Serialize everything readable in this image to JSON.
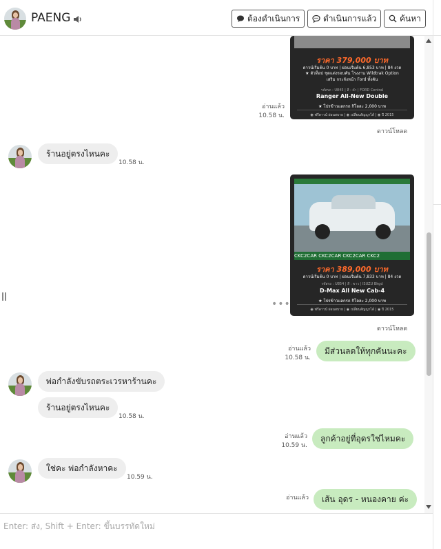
{
  "header": {
    "contact_name": "PAENG",
    "buttons": {
      "todo": "ต้องดำเนินการ",
      "done": "ดำเนินการแล้ว",
      "search": "ค้นหา"
    }
  },
  "cards": [
    {
      "price": "ราคา 379,000 บาท",
      "finance": "ดาวน์เริ่มต้น 0 บาท | ผ่อนเริ่มต้น 6,853 บาท | 84 งวด",
      "options": [
        "★ ตัวท็อป ชุดแต่งรอบคัน โรงงาน Wildtrak Option",
        "เสริม กระจังหน้า Ford ทั้งคัน"
      ],
      "spec": "รหัสรถ : U845 | สี : ดำ | FORD Central",
      "model": "Ranger All-New Double",
      "promo": "★ โปรข้าวแลกรถ กิโลละ 2,000 บาท",
      "footer": "◉ ฟรีดาวน์ ผ่อนสบาย | ◉ เปลี่ยนสัญญาได้ | ◉ ปี 2015"
    },
    {
      "brand_strip": "CKC2CAR CKC2CAR CKC2CAR CKC2",
      "price": "ราคา 389,000 บาท",
      "finance": "ดาวน์เริ่มต้น 0 บาท | ผ่อนเริ่มต้น 7,833 บาท | 84 งวด",
      "spec": "รหัสรถ : U854 | สี : ขาว | ISUZU Bkgd",
      "model": "D-Max All New Cab-4",
      "promo": "★ โปรข้าวแลกรถ กิโลละ 2,000 บาท",
      "footer": "◉ ฟรีดาวน์ ผ่อนสบาย | ◉ เปลี่ยนสัญญาได้ | ◉ ปี 2015"
    }
  ],
  "messages": {
    "read_label": "อ่านแล้ว",
    "download_label": "ดาวน์โหลด",
    "card1_time": "10.58 น.",
    "in1": {
      "text": "ร้านอยู่ตรงไหนคะ",
      "time": "10.58 น."
    },
    "out1": {
      "text": "มีส่วนลดให้ทุกคันนะคะ",
      "time": "10.58 น."
    },
    "in2": {
      "text": "พ่อกำลังขับรถตระเวรหาร้านคะ"
    },
    "in3": {
      "text": "ร้านอยู่ตรงไหนคะ",
      "time": "10.58 น."
    },
    "out2": {
      "text": "ลูกค้าอยู่ที่อุดรใช่ไหมคะ",
      "time": "10.59 น."
    },
    "in4": {
      "text": "ใช่คะ พ่อกำลังหาคะ",
      "time": "10.59 น."
    },
    "out3": {
      "text": "เส้น อุดร - หนองคาย ค่ะ"
    }
  },
  "composer": {
    "placeholder": "Enter: ส่ง, Shift + Enter: ขึ้นบรรทัดใหม่"
  }
}
